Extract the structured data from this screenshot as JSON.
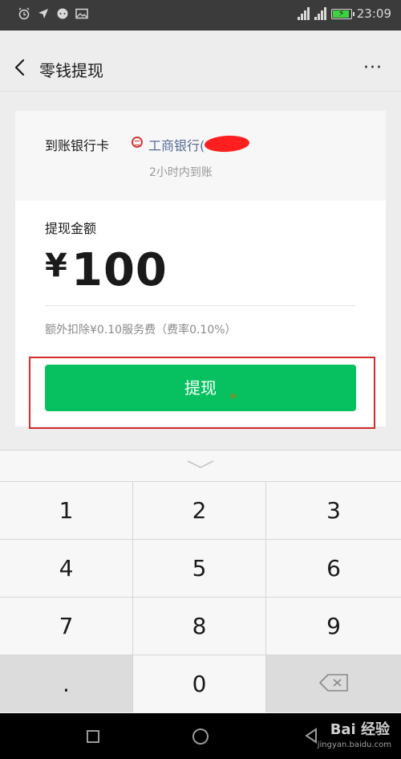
{
  "status_bar": {
    "time": "23:09",
    "battery_level": 0.9,
    "icons": [
      "alarm-icon",
      "location-icon",
      "chat-icon",
      "image-icon",
      "sim-signal-icon",
      "battery-charging-icon"
    ]
  },
  "nav": {
    "title": "零钱提现",
    "back_icon": "chevron-left-icon",
    "more_label": "···"
  },
  "withdraw": {
    "bank_label": "到账银行卡",
    "bank_name": "工商银行(",
    "arrival_time": "2小时内到账",
    "amount_label": "提现金额",
    "currency": "¥",
    "amount": "100",
    "fee_note": "额外扣除¥0.10服务费（费率0.10%）",
    "button_label": "提现"
  },
  "keypad": {
    "keys": [
      "1",
      "2",
      "3",
      "4",
      "5",
      "6",
      "7",
      "8",
      "9",
      ".",
      "0"
    ],
    "backspace_icon": "backspace-icon"
  },
  "system_nav": {
    "icons": [
      "recent-apps-icon",
      "home-icon",
      "back-icon"
    ]
  },
  "watermark": {
    "text": "Bai 经验",
    "sub": "jingyan.baidu.com"
  },
  "colors": {
    "primary_button": "#07c160",
    "link": "#576b95",
    "highlight_box": "#d12b2b"
  }
}
